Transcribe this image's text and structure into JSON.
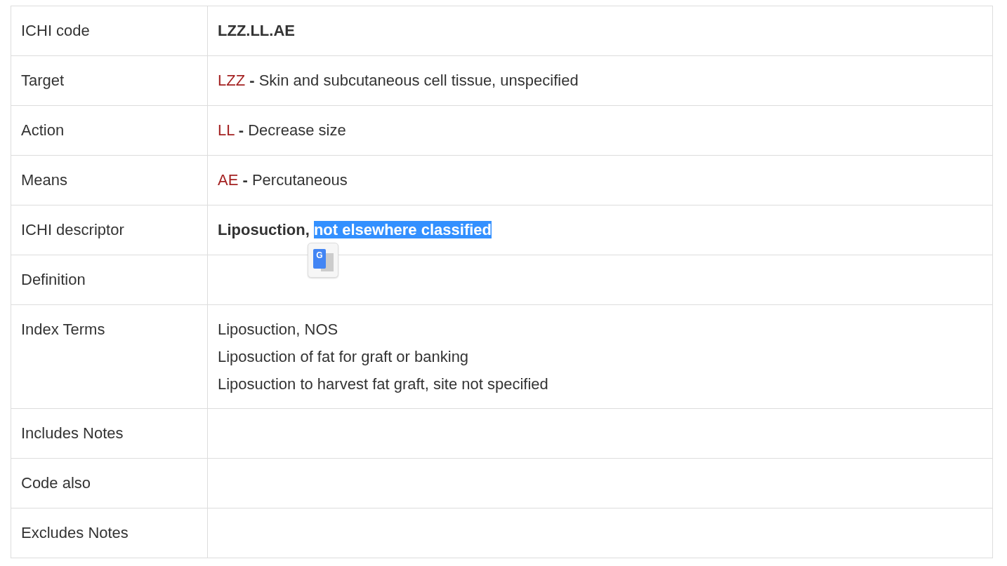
{
  "rows": [
    {
      "label": "ICHI code",
      "kind": "code",
      "value": "LZZ.LL.AE"
    },
    {
      "label": "Target",
      "kind": "axis",
      "code": "LZZ",
      "description": "**-** Skin and subcutaneous cell tissue, unspecified"
    },
    {
      "label": "Action",
      "kind": "axis",
      "code": "LL",
      "description": "**-** Decrease size"
    },
    {
      "label": "Means",
      "kind": "axis",
      "code": "AE",
      "description": "**-** Percutaneous"
    },
    {
      "label": "ICHI descriptor",
      "kind": "descriptor",
      "text": "Liposuction,",
      "selection": "not elsewhere classified"
    },
    {
      "label": "Definition",
      "kind": "empty"
    },
    {
      "label": "Index Terms",
      "kind": "list",
      "lines": [
        "Liposuction, NOS",
        "Liposuction of fat for graft or banking",
        "Liposuction to harvest fat graft, site not specified"
      ]
    },
    {
      "label": "Includes Notes",
      "kind": "empty"
    },
    {
      "label": "Code also",
      "kind": "empty"
    },
    {
      "label": "Excludes Notes",
      "kind": "empty"
    }
  ],
  "translate_popup": {
    "label": "G"
  }
}
